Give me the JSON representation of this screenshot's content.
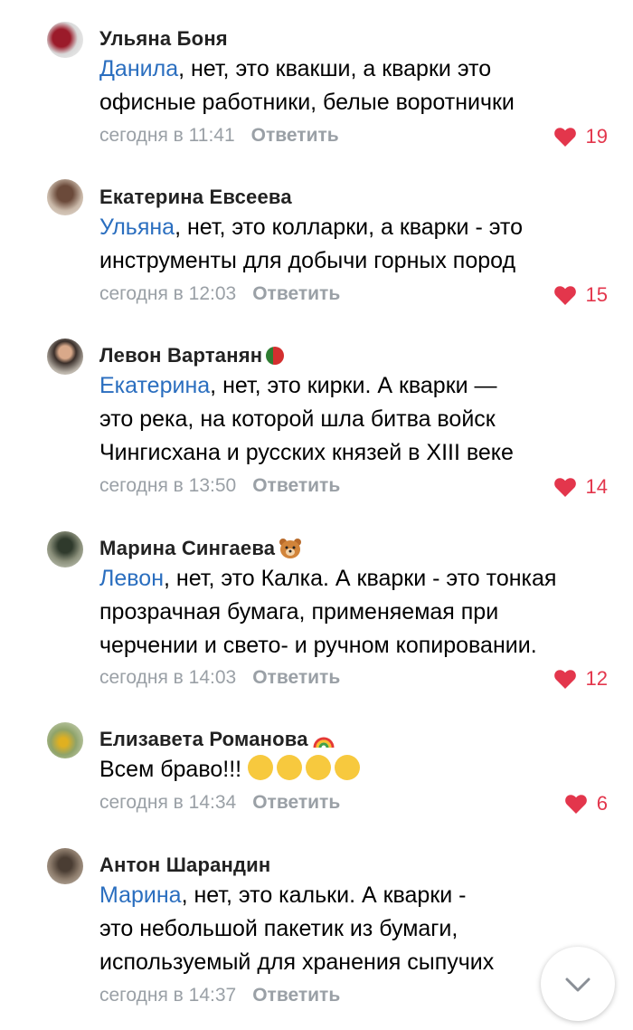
{
  "comments": [
    {
      "author": "Ульяна Боня",
      "mention": "Данила",
      "lines": [
        ", нет, это квакши, а кварки это",
        "офисные работники, белые воротнички"
      ],
      "time": "сегодня в 11:41",
      "likes": "19"
    },
    {
      "author": "Екатерина Евсеева",
      "mention": "Ульяна",
      "lines": [
        ", нет, это колларки, а кварки - это",
        "инструменты для добычи горных пород"
      ],
      "time": "сегодня в 12:03",
      "likes": "15"
    },
    {
      "author": "Левон Вартанян",
      "mention": "Екатерина",
      "lines": [
        ", нет, это кирки. А кварки —",
        "это река, на которой шла битва войск",
        "Чингисхана и русских князей в XIII веке"
      ],
      "time": "сегодня в 13:50",
      "likes": "14"
    },
    {
      "author": "Марина Сингаева",
      "mention": "Левон",
      "lines": [
        ", нет, это Калка. А кварки - это тонкая",
        "прозрачная бумага, применяемая при",
        "черчении и свето- и ручном копировании."
      ],
      "time": "сегодня в 14:03",
      "likes": "12"
    },
    {
      "author": "Елизавета Романова",
      "text": "Всем браво!!!",
      "time": "сегодня в 14:34",
      "likes": "6"
    },
    {
      "author": "Антон Шарандин",
      "mention": "Марина",
      "lines": [
        ", нет, это кальки. А кварки -",
        "это небольшой пакетик из бумаги,",
        "используемый для хранения сыпучих"
      ],
      "time": "сегодня в 14:37"
    }
  ],
  "reply_label": "Ответить",
  "icons": {
    "like": "heart-icon",
    "scroll": "chevron-down-icon",
    "emoji": "rolling-laughing-emoji"
  },
  "colors": {
    "mention": "#2a6ebf",
    "meta": "#9aa0a6",
    "like": "#e3364c"
  }
}
